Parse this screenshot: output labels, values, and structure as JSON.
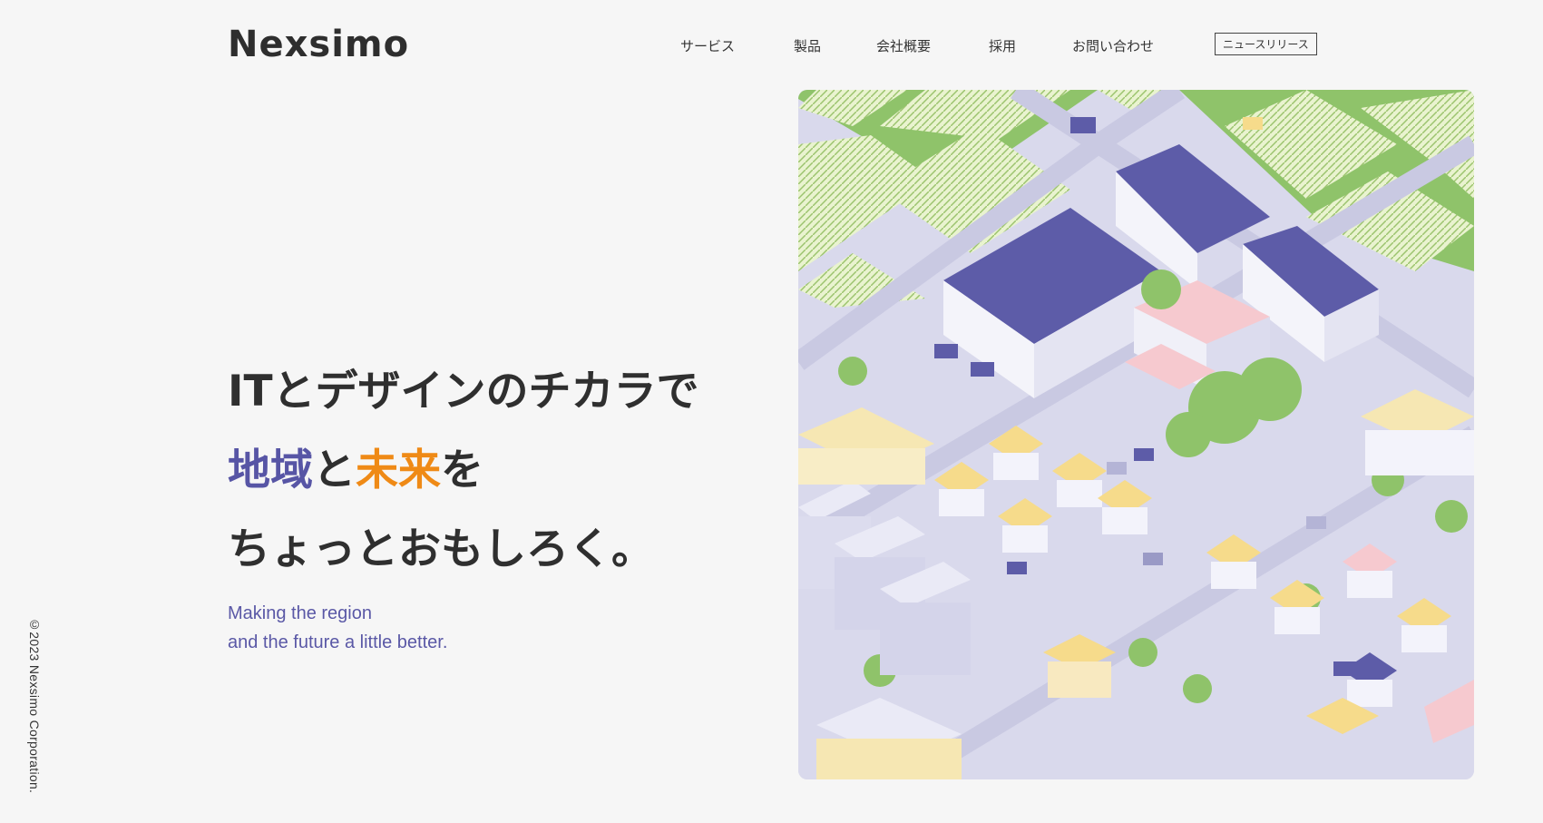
{
  "brand": {
    "logo_text": "Nexsimo"
  },
  "nav": {
    "items": [
      "サービス",
      "製品",
      "会社概要",
      "採用",
      "お問い合わせ"
    ],
    "news_button": "ニュースリリース"
  },
  "hero": {
    "headline_line1": "ITとデザインのチカラで",
    "headline_line2_part1": "地域",
    "headline_line2_part2": "と",
    "headline_line2_part3": "未来",
    "headline_line2_part4": "を",
    "headline_line3": "ちょっとおもしろく。",
    "sub_line1": "Making the region",
    "sub_line2": "and the future a little better.",
    "illustration": "isometric-city-illustration"
  },
  "footer": {
    "copyright": "©2023 Nexsimo Corporation."
  },
  "colors": {
    "background": "#f6f6f6",
    "accent_purple": "#5755a5",
    "accent_orange": "#ef8a16",
    "text": "#2f2f2f"
  }
}
